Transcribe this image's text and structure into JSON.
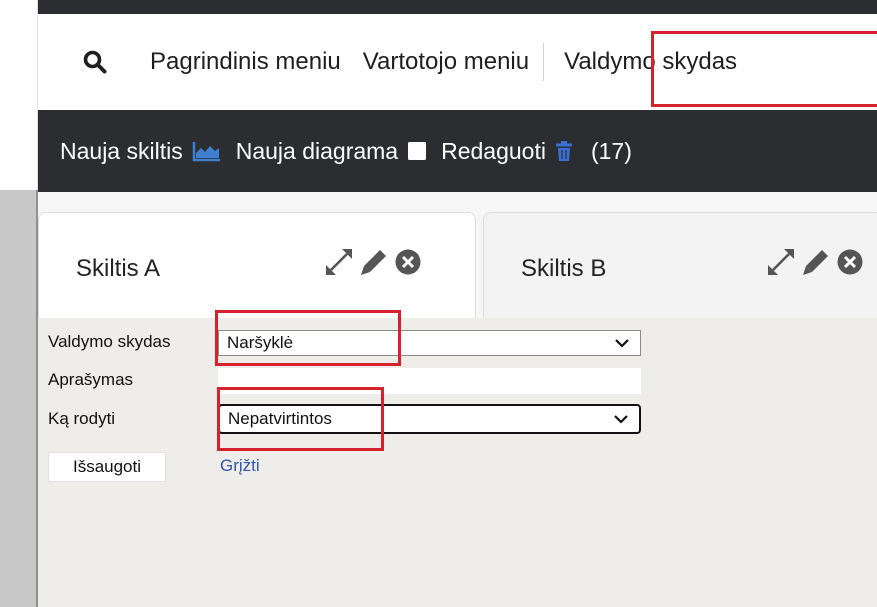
{
  "nav": {
    "items": [
      {
        "label": "Pagrindinis meniu"
      },
      {
        "label": "Vartotojo meniu"
      },
      {
        "label": "Valdymo skydas"
      }
    ]
  },
  "toolbar": {
    "new_column_label": "Nauja skiltis",
    "new_chart_label": "Nauja diagrama",
    "edit_label": "Redaguoti",
    "count_label": "(17)"
  },
  "tabs": [
    {
      "label": "Skiltis A"
    },
    {
      "label": "Skiltis B"
    }
  ],
  "form": {
    "dashboard_label": "Valdymo skydas",
    "dashboard_value": "Naršyklė",
    "description_label": "Aprašymas",
    "description_value": "",
    "show_label": "Ką rodyti",
    "show_value": "Nepatvirtintos",
    "save_label": "Išsaugoti",
    "back_label": "Grįžti"
  },
  "colors": {
    "dark_bar": "#2b2d30",
    "highlight": "#d6222c",
    "chart_icon": "#3f7fd0",
    "trash_icon": "#3b6fd6",
    "link": "#2f56a8",
    "panel_bg": "#efede9"
  }
}
